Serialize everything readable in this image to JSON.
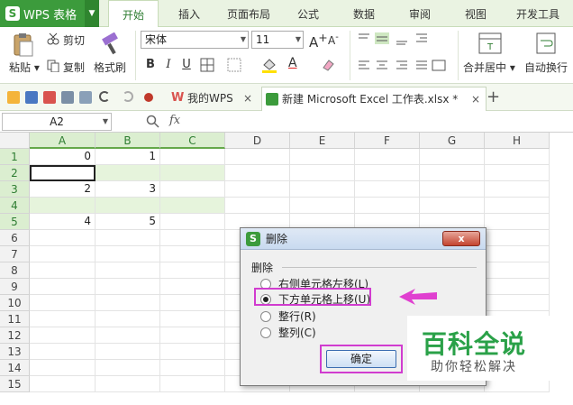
{
  "app": {
    "name": "WPS 表格",
    "logo": "S"
  },
  "menu": {
    "tabs": [
      "开始",
      "插入",
      "页面布局",
      "公式",
      "数据",
      "审阅",
      "视图",
      "开发工具"
    ],
    "active": "开始"
  },
  "ribbon": {
    "paste": "粘贴",
    "cut": "剪切",
    "copy": "复制",
    "format_painter": "格式刷",
    "font_name": "宋体",
    "font_size": "11",
    "grow": "A",
    "shrink": "A",
    "bold": "B",
    "italic": "I",
    "underline": "U",
    "merge_center": "合并居中",
    "wrap_text": "自动换行"
  },
  "quickbar": {
    "tab1": "我的WPS",
    "tab2": "新建 Microsoft Excel 工作表.xlsx *",
    "close": "×",
    "add": "+"
  },
  "formula": {
    "cell_ref": "A2",
    "fx": "fx"
  },
  "sheet": {
    "columns": [
      "A",
      "B",
      "C",
      "D",
      "E",
      "F",
      "G",
      "H"
    ],
    "rows": [
      "1",
      "2",
      "3",
      "4",
      "5",
      "6",
      "7",
      "8",
      "9",
      "10",
      "11",
      "12",
      "13",
      "14",
      "15"
    ],
    "cells": {
      "A1": "0",
      "B1": "1",
      "A3": "2",
      "B3": "3",
      "A5": "4",
      "B5": "5"
    }
  },
  "dialog": {
    "title": "删除",
    "close": "x",
    "group_label": "删除",
    "options": [
      "右侧单元格左移(L)",
      "下方单元格上移(U)",
      "整行(R)",
      "整列(C)"
    ],
    "selected": 1,
    "ok": "确定"
  },
  "watermark": {
    "title": "百科全说",
    "subtitle": "助你轻松解决"
  },
  "colors": {
    "accent": "#3c9b3c",
    "highlight": "#d13ccf",
    "selection": "#e6f4dc",
    "watermark": "#2aa148"
  }
}
